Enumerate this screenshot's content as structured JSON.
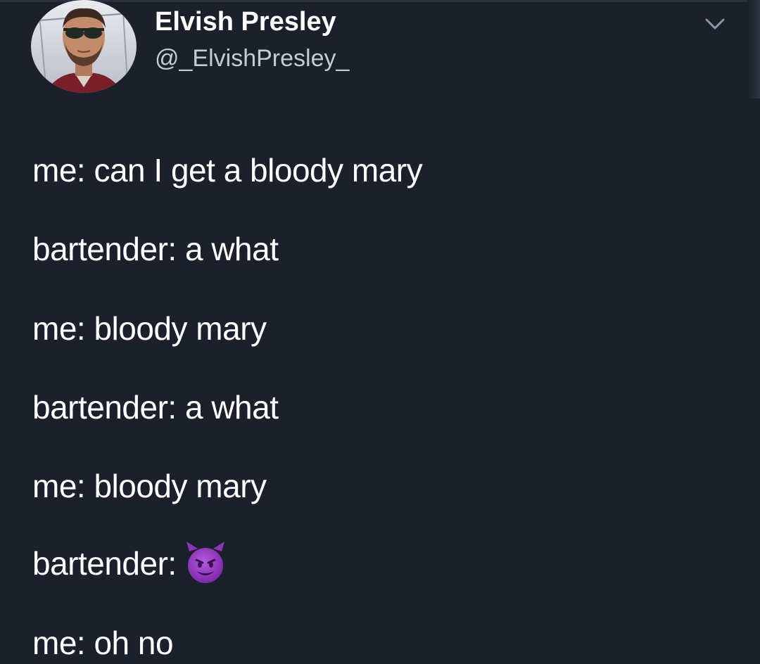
{
  "author": {
    "name": "Elvish Presley",
    "handle": "@_ElvishPresley_"
  },
  "icons": {
    "menu": "chevron-down-icon",
    "emoji": "smiling-imp-emoji"
  },
  "tweet": {
    "lines": [
      "me: can I get a bloody mary",
      "bartender: a what",
      "me: bloody mary",
      "bartender: a what",
      "me: bloody mary",
      "bartender:",
      "me: oh no"
    ],
    "emoji_after_line_6": "smiling-imp-emoji"
  },
  "colors": {
    "background": "#1b202b",
    "text": "#ffffff",
    "handle": "#c6cbd2",
    "emoji": "#9b3fc9"
  }
}
